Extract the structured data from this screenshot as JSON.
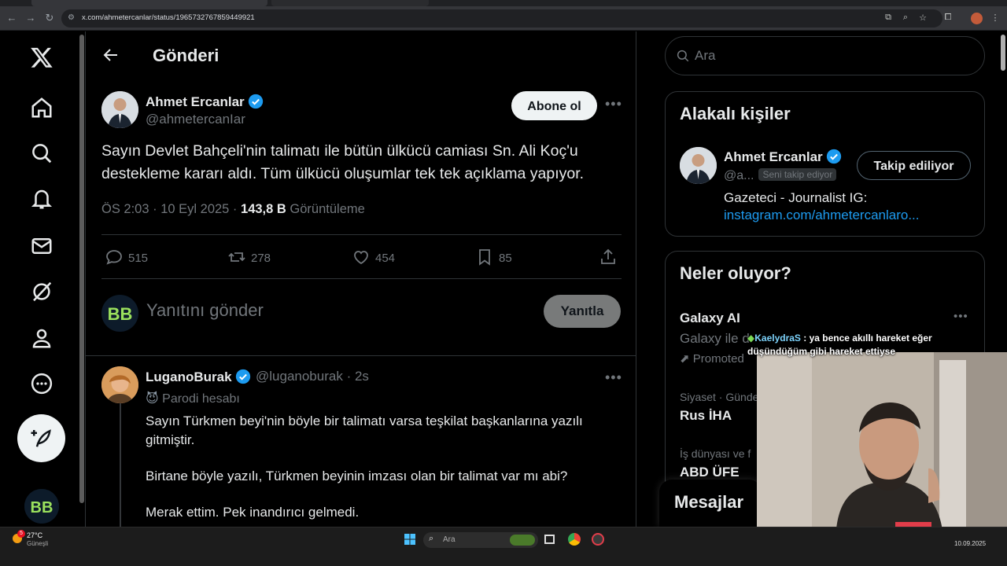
{
  "browser": {
    "url": "x.com/ahmetercanlar/status/1965732767859449921"
  },
  "page": {
    "title": "Gönderi"
  },
  "tweet": {
    "author_name": "Ahmet Ercanlar",
    "author_handle": "@ahmetercanIar",
    "follow_label": "Abone ol",
    "text": "Sayın Devlet Bahçeli'nin talimatı ile bütün ülkücü camiası Sn. Ali Koç'u destekleme kararı aldı. Tüm ülkücü oluşumlar tek tek açıklama yapıyor.",
    "time": "ÖS 2:03 · 10 Eyl 2025 · ",
    "views_count": "143,8 B",
    "views_label": "Görüntüleme",
    "replies": "515",
    "reposts": "278",
    "likes": "454",
    "bookmarks": "85"
  },
  "composer": {
    "placeholder": "Yanıtını gönder",
    "reply_label": "Yanıtla"
  },
  "reply": {
    "author_name": "LuganoBurak",
    "author_handle": "@luganoburak",
    "age": "· 2s",
    "parody_label": "Parodi hesabı",
    "para1": "Sayın Türkmen beyi'nin böyle bir talimatı varsa teşkilat başkanlarına yazılı gitmiştir.",
    "para2": "Birtane böyle yazılı, Türkmen beyinin imzası olan bir talimat var mı abi?",
    "para3": "Merak ettim. Pek inandırıcı gelmedi."
  },
  "search": {
    "placeholder": "Ara"
  },
  "related": {
    "title": "Alakalı kişiler",
    "name": "Ahmet Ercanlar",
    "handle": "@a...",
    "follows_you": "Seni takip ediyor",
    "following_label": "Takip ediliyor",
    "bio": "Gazeteci - Journalist IG:",
    "link": "instagram.com/ahmetercanlaro..."
  },
  "trends": {
    "title": "Neler oluyor?",
    "items": [
      {
        "context": "",
        "name": "Galaxy AI",
        "sub": "Galaxy ile d",
        "promo": "Promoted"
      },
      {
        "context": "Siyaset · Gündem",
        "name": "Rus İHA"
      },
      {
        "context": "İş dünyası ve f",
        "name": "ABD ÜFE"
      }
    ]
  },
  "messages": {
    "title": "Mesajlar"
  },
  "overlay": {
    "chat_user": "KaelydraS",
    "chat_text_1": ": ya bence akıllı hareket eğer",
    "chat_text_2": "düşündüğüm gibi hareket ettiyse"
  },
  "taskbar": {
    "temperature": "27°C",
    "weather": "Güneşli",
    "search_label": "Ara",
    "date": "10.09.2025",
    "notif_count": "5"
  },
  "colors": {
    "accent": "#1d9bf0",
    "background": "#000000",
    "text": "#e7e9ea",
    "muted": "#71767b",
    "border": "#2f3336"
  }
}
